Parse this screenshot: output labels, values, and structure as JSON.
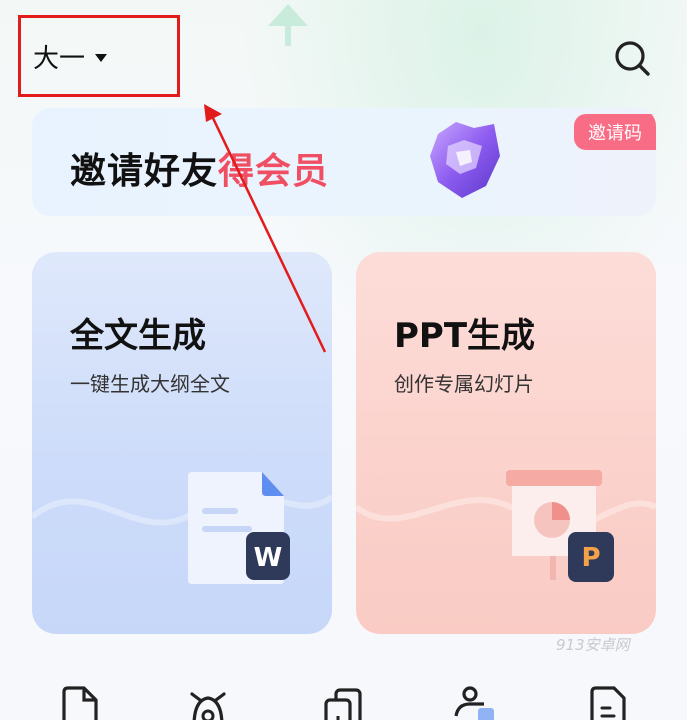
{
  "header": {
    "grade_label": "大一",
    "icons": {
      "caret": "caret-down-icon",
      "search": "search-icon"
    }
  },
  "invite_banner": {
    "text_black": "邀请好友",
    "text_red": "得会员",
    "badge": "邀请码",
    "icon": "gem-icon"
  },
  "cards": [
    {
      "title": "全文生成",
      "subtitle": "一键生成大纲全文",
      "icon": "word-doc-icon",
      "badge_letter": "W"
    },
    {
      "title": "PPT生成",
      "subtitle": "创作专属幻灯片",
      "icon": "ppt-board-icon",
      "badge_letter": "P"
    }
  ],
  "watermark": "913安卓网",
  "tools": [
    "doc-tool-icon",
    "bear-tool-icon",
    "copy-tool-icon",
    "person-tool-icon",
    "file-tool-icon"
  ],
  "colors": {
    "annotation_red": "#e21b1b",
    "invite_red": "#f04f63",
    "badge_pink": "#f86c86",
    "card_blue": "#cddcfa",
    "card_pink": "#fbd2cc",
    "icon_navy": "#2f3a5a"
  }
}
